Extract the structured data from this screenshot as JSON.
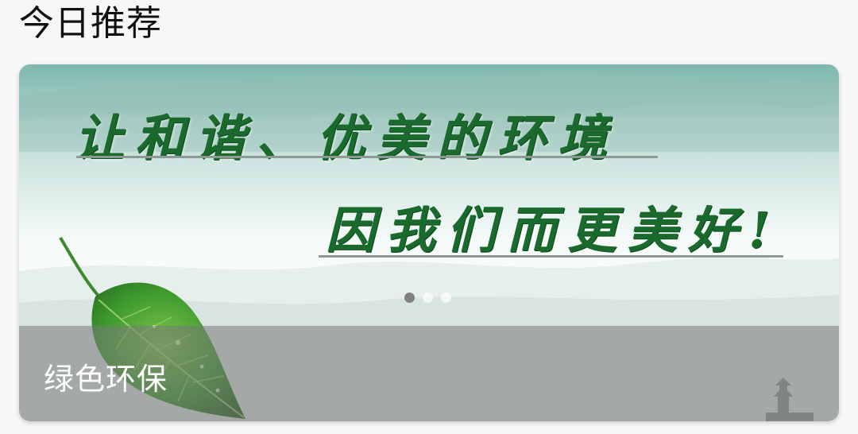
{
  "section": {
    "title": "今日推荐"
  },
  "banner": {
    "slogan_line1": "让和谐、优美的环境",
    "slogan_line2": "因我们而更美好!",
    "caption": "绿色环保",
    "active_slide": 1,
    "slide_count": 3,
    "colors": {
      "slogan_green": "#1a6a2e",
      "caption_bar": "#787878"
    }
  }
}
